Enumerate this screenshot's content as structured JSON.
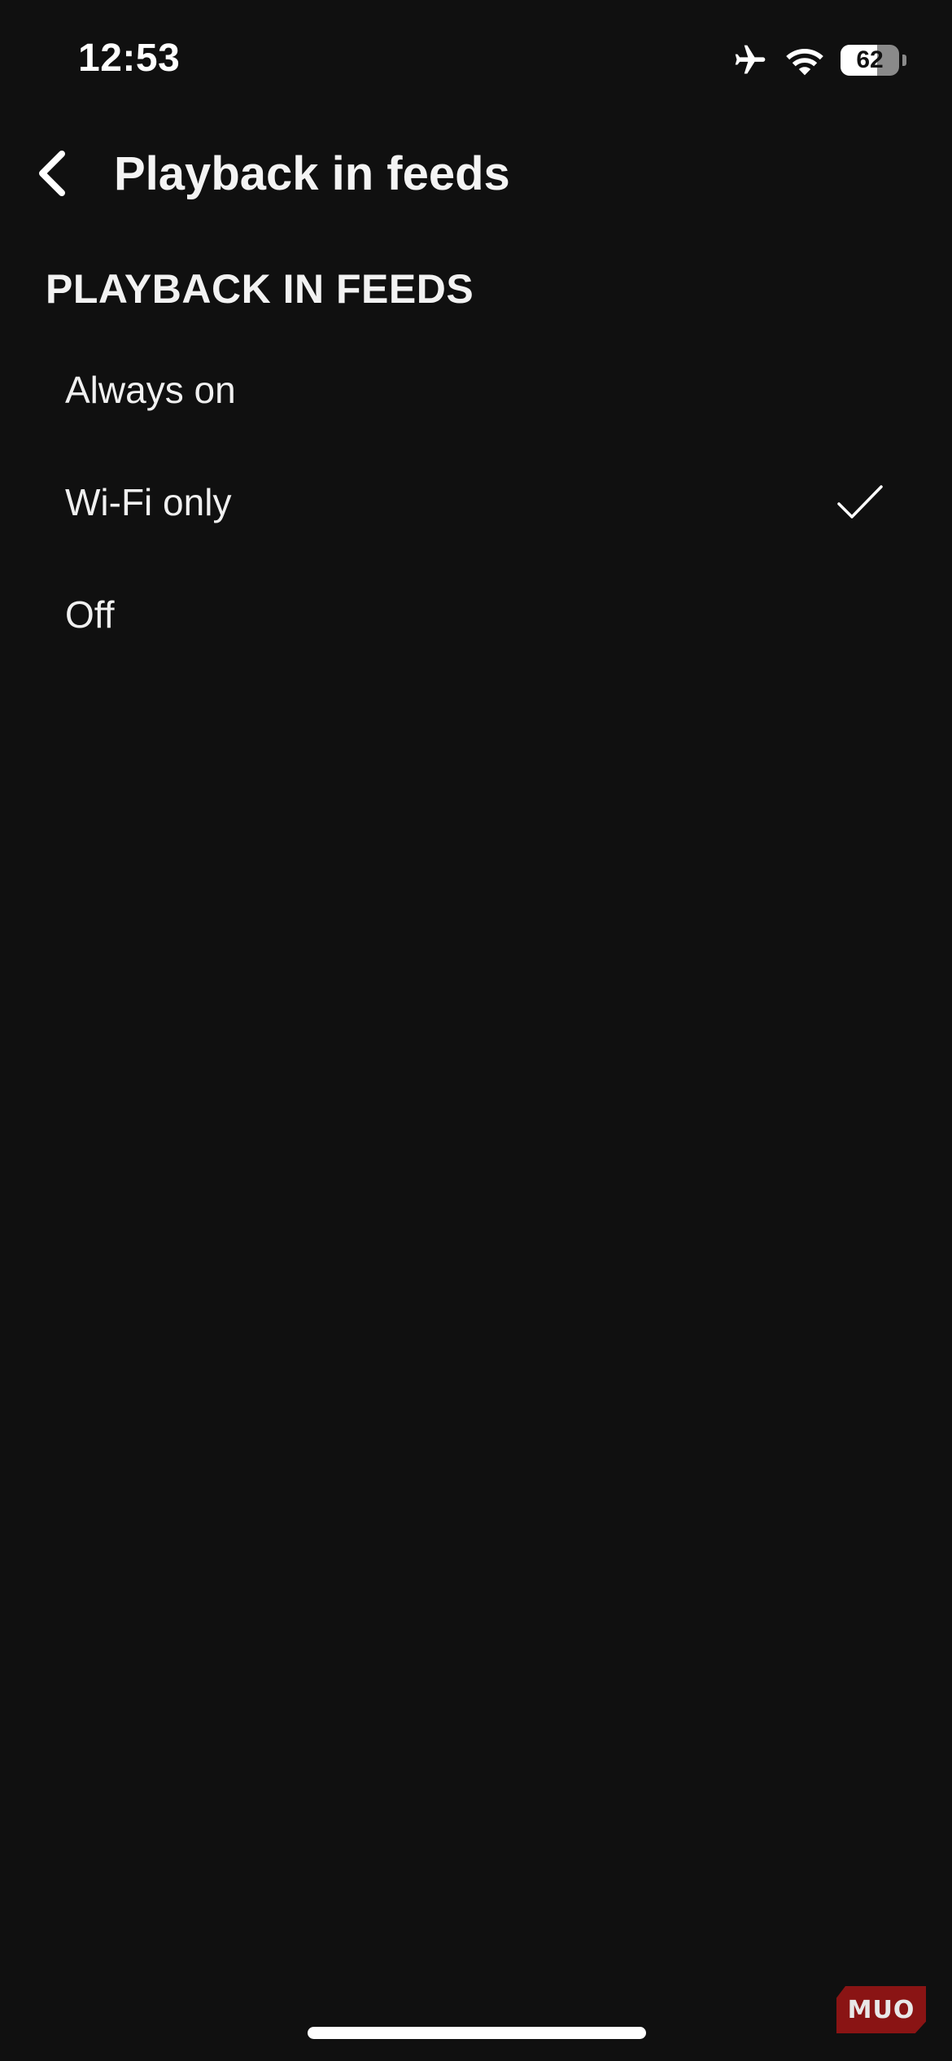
{
  "status_bar": {
    "time": "12:53",
    "battery_level": 62,
    "battery_label": "62",
    "icons": [
      "airplane-icon",
      "wifi-icon",
      "battery-icon"
    ]
  },
  "header": {
    "back_icon": "chevron-left-icon",
    "title": "Playback in feeds"
  },
  "section": {
    "title": "PLAYBACK IN FEEDS",
    "options": [
      {
        "label": "Always on",
        "selected": false
      },
      {
        "label": "Wi-Fi only",
        "selected": true
      },
      {
        "label": "Off",
        "selected": false
      }
    ],
    "check_icon": "checkmark-icon"
  },
  "watermark": {
    "text": "MUO"
  },
  "colors": {
    "background": "#101010",
    "text": "#f2f2f2",
    "watermark": "#8a1414"
  }
}
